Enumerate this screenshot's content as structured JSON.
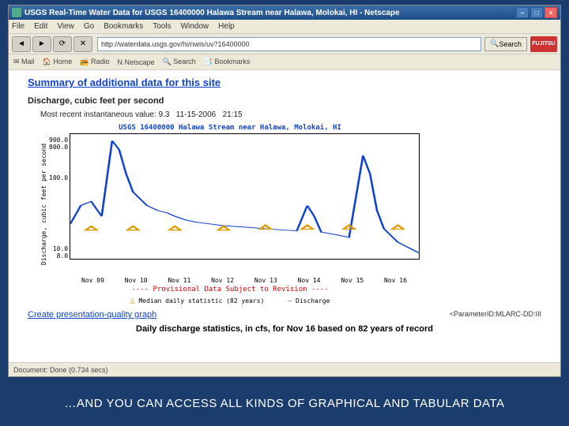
{
  "titlebar": {
    "title": "USGS Real-Time Water Data for USGS 16400000 Halawa Stream near Halawa, Molokai, HI - Netscape"
  },
  "menubar": {
    "items": [
      "File",
      "Edit",
      "View",
      "Go",
      "Bookmarks",
      "Tools",
      "Window",
      "Help"
    ]
  },
  "navbar": {
    "url": "http://waterdata.usgs.gov/hi/nwis/uv?16400000",
    "search_label": "Search",
    "logo": "FUJITSU"
  },
  "toolbar2": {
    "items": [
      "Mail",
      "Home",
      "Radio",
      "Netscape",
      "Search",
      "Bookmarks"
    ]
  },
  "content": {
    "section_title": "Summary of additional data for this site",
    "subhead": "Discharge, cubic feet per second",
    "recent_label": "Most recent instantaneous value:",
    "recent_value": "9.3",
    "recent_date": "11-15-2006",
    "recent_time": "21:15",
    "provisional": "---- Provisional Data Subject to Revision ----",
    "legend_median": "Median daily statistic (82 years)",
    "legend_disch": "Discharge",
    "link2": "Create presentation-quality graph",
    "param": "<ParameterID:MLARC-DD:III",
    "stats_head": "Daily discharge statistics, in cfs, for Nov 16 based on 82 years of record"
  },
  "chart_data": {
    "type": "line",
    "title": "USGS 16400000 Halawa Stream near Halawa, Molokai, HI",
    "ylabel": "Discharge, cubic feet per second",
    "yscale": "log",
    "ylim": [
      8,
      900
    ],
    "yticks": [
      "900.0",
      "800.0",
      "100.0",
      "10.0",
      "8.0"
    ],
    "categories": [
      "Nov 09",
      "Nov 10",
      "Nov 11",
      "Nov 12",
      "Nov 13",
      "Nov 14",
      "Nov 15",
      "Nov 16"
    ],
    "series": [
      {
        "name": "Discharge",
        "color": "#1144cc",
        "x": [
          0,
          3,
          6,
          9,
          12,
          14,
          16,
          18,
          22,
          25,
          28,
          30,
          33,
          36,
          40,
          44,
          48,
          52,
          56,
          60,
          65,
          68,
          70,
          72,
          76,
          80,
          84,
          86,
          88,
          90,
          94,
          100
        ],
        "y": [
          30,
          60,
          70,
          40,
          700,
          500,
          200,
          100,
          60,
          50,
          45,
          40,
          35,
          32,
          30,
          28,
          27,
          26,
          25,
          24,
          23,
          60,
          40,
          22,
          20,
          18,
          400,
          200,
          50,
          25,
          15,
          10
        ]
      },
      {
        "name": "Median daily statistic (82 years)",
        "color": "#d90",
        "marker": "triangle",
        "x": [
          6,
          18,
          30,
          44,
          56,
          68,
          80,
          94
        ],
        "y": [
          25,
          25,
          25,
          25,
          26,
          26,
          26,
          26
        ]
      }
    ]
  },
  "statusbar": {
    "text": "Document: Done (0.734 secs)"
  },
  "caption": "…AND YOU CAN ACCESS ALL KINDS OF GRAPHICAL AND TABULAR DATA"
}
